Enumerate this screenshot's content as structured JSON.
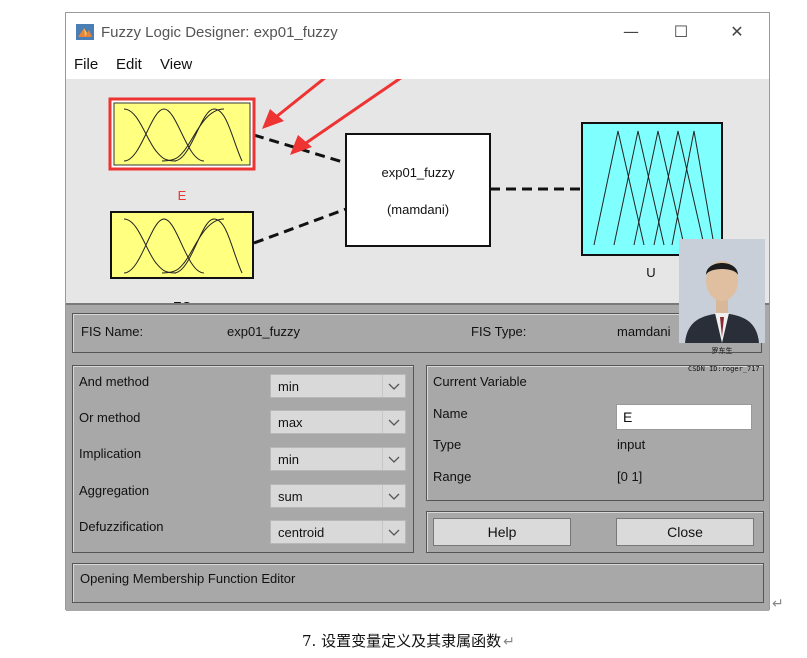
{
  "window": {
    "title": "Fuzzy Logic Designer: exp01_fuzzy",
    "controls": {
      "minimize": "—",
      "maximize": "☐",
      "close": "✕"
    }
  },
  "menu": [
    "File",
    "Edit",
    "View"
  ],
  "diagram": {
    "inputs": [
      {
        "name": "E",
        "selected": true
      },
      {
        "name": "EC",
        "selected": false
      }
    ],
    "system": {
      "name": "exp01_fuzzy",
      "type": "(mamdani)"
    },
    "output": {
      "name": "U"
    },
    "colors": {
      "input_fill": "#ffff80",
      "output_fill": "#80ffff",
      "selected_border": "#ee3333",
      "selected_label": "#ee3333"
    }
  },
  "fis": {
    "name_label": "FIS Name:",
    "name_value": "exp01_fuzzy",
    "type_label": "FIS Type:",
    "type_value": "mamdani"
  },
  "methods": [
    {
      "label": "And method",
      "value": "min"
    },
    {
      "label": "Or method",
      "value": "max"
    },
    {
      "label": "Implication",
      "value": "min"
    },
    {
      "label": "Aggregation",
      "value": "sum"
    },
    {
      "label": "Defuzzification",
      "value": "centroid"
    }
  ],
  "current_variable": {
    "heading": "Current Variable",
    "name_label": "Name",
    "name_value": "E",
    "type_label": "Type",
    "type_value": "input",
    "range_label": "Range",
    "range_value": "[0 1]"
  },
  "buttons": {
    "help": "Help",
    "close": "Close"
  },
  "status": "Opening Membership Function Editor",
  "watermark": {
    "signature": "罗东生",
    "id": "CSDN ID:roger_717"
  },
  "caption": "7.  设置变量定义及其隶属函数",
  "return_mark": "↵"
}
